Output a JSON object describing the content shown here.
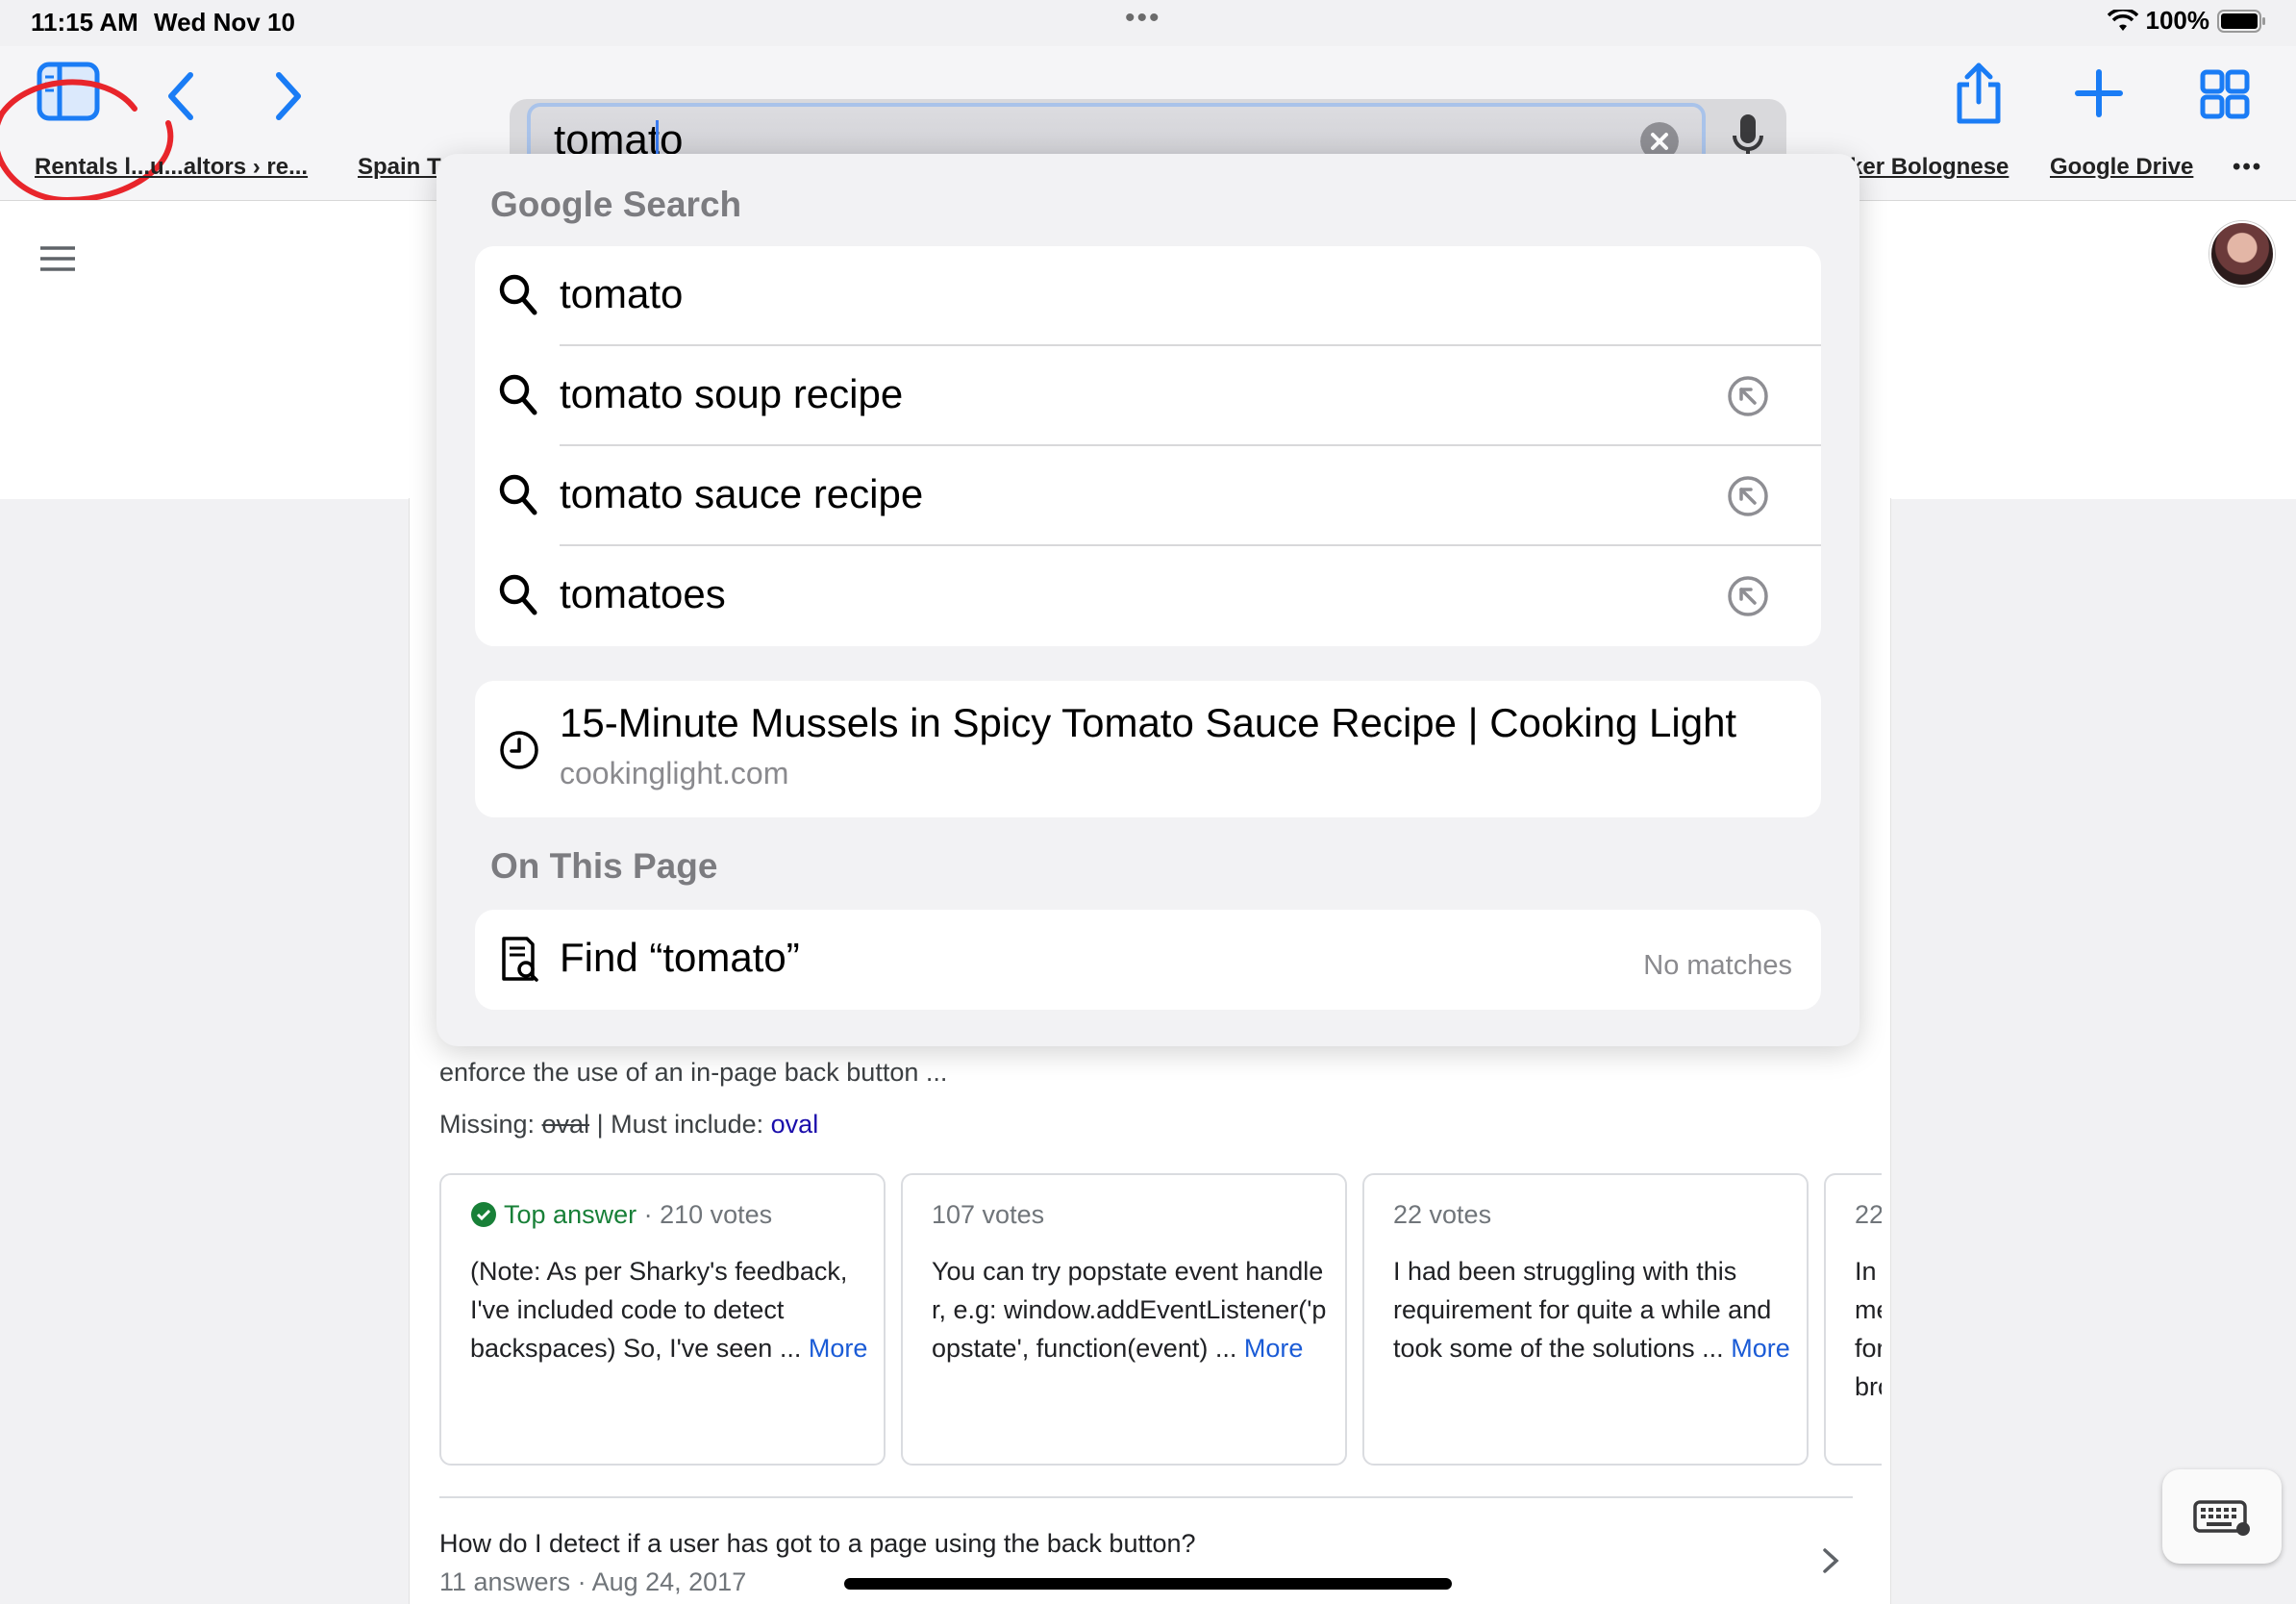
{
  "status_bar": {
    "time": "11:15 AM",
    "date": "Wed Nov 10",
    "battery": "100%",
    "icons": [
      "wifi-icon",
      "battery-icon"
    ]
  },
  "toolbar": {
    "search_value": "tomato",
    "icons": [
      "sidebar-icon",
      "back-icon",
      "forward-icon",
      "clear-icon",
      "microphone-icon",
      "share-icon",
      "new-tab-icon",
      "tabs-overview-icon"
    ],
    "accent": "#1a7cf5"
  },
  "favorites": {
    "items": [
      {
        "label": "Rentals l...u...altors › re..."
      },
      {
        "label": "Spain T"
      },
      {
        "label": "ker Bolognese"
      },
      {
        "label": "Google Drive"
      }
    ],
    "overflow": "•••"
  },
  "dropdown": {
    "google_header": "Google Search",
    "suggestions": [
      {
        "text": "tomato",
        "autofill": false
      },
      {
        "text": "tomato soup recipe",
        "autofill": true
      },
      {
        "text": "tomato sauce recipe",
        "autofill": true
      },
      {
        "text": "tomatoes",
        "autofill": true
      }
    ],
    "history": {
      "title": "15-Minute Mussels in Spicy Tomato Sauce Recipe | Cooking Light",
      "url": "cookinglight.com"
    },
    "on_page_header": "On This Page",
    "find_label": "Find “tomato”",
    "find_status": "No matches"
  },
  "page": {
    "snippet_1": "enforce the use of an in-page back button ...",
    "missing_prefix": "Missing: ",
    "missing_word": "oval",
    "must_include_prefix": " | Must include: ",
    "must_include_word": "oval",
    "answers": [
      {
        "badge": "Top answer",
        "votes": "· 210 votes",
        "body": "(Note: As per Sharky's feedback, I've included code to detect backspaces) So, I've seen ...",
        "more": "More"
      },
      {
        "badge": "",
        "votes": "107 votes",
        "body": "You can try popstate event handler, e.g: window.addEventListener('popstate', function(event) ...",
        "more": "More"
      },
      {
        "badge": "",
        "votes": "22 votes",
        "body": "I had been struggling with this requirement for quite a while and took some of the solutions ...",
        "more": "More"
      },
      {
        "badge": "",
        "votes": "22",
        "body": "In me for bro",
        "more": ""
      }
    ],
    "question": "How do I detect if a user has got to a page using the back button?",
    "question_meta": "11 answers · Aug 24, 2017"
  }
}
